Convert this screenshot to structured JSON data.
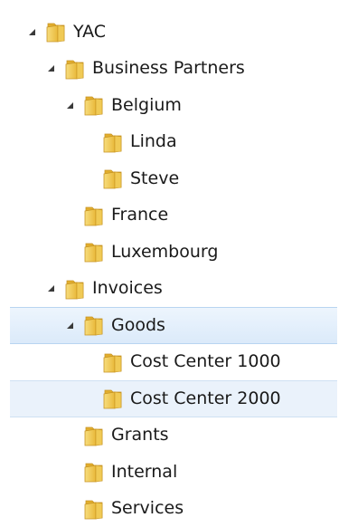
{
  "icons": {
    "expanded_arrow": "expanded-arrow-icon",
    "folder": "folder-icon"
  },
  "colors": {
    "selection_fill": "#dbeafa",
    "selection_border": "#b8d4f1",
    "folder_fill": "#f2c94c",
    "arrow": "#3a3a3a"
  },
  "tree": [
    {
      "label": "YAC",
      "level": 0,
      "expanded": true
    },
    {
      "label": "Business Partners",
      "level": 1,
      "expanded": true
    },
    {
      "label": "Belgium",
      "level": 2,
      "expanded": true
    },
    {
      "label": "Linda",
      "level": 3
    },
    {
      "label": "Steve",
      "level": 3
    },
    {
      "label": "France",
      "level": 2
    },
    {
      "label": "Luxembourg",
      "level": 2
    },
    {
      "label": "Invoices",
      "level": 1,
      "expanded": true
    },
    {
      "label": "Goods",
      "level": 2,
      "expanded": true,
      "selected": true
    },
    {
      "label": "Cost Center 1000",
      "level": 3
    },
    {
      "label": "Cost Center 2000",
      "level": 3,
      "hovered": true
    },
    {
      "label": "Grants",
      "level": 2
    },
    {
      "label": "Internal",
      "level": 2
    },
    {
      "label": "Services",
      "level": 2
    }
  ]
}
